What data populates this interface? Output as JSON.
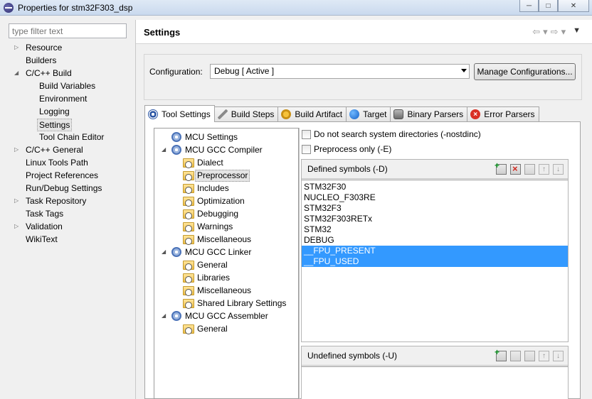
{
  "window": {
    "title": "Properties for stm32F303_dsp",
    "buttons": [
      "─",
      "□",
      "✕"
    ]
  },
  "filter": {
    "placeholder": "type filter text"
  },
  "nav": {
    "items": [
      {
        "label": "Resource",
        "arrow": "▷",
        "child": false
      },
      {
        "label": "Builders",
        "arrow": "",
        "child": false
      },
      {
        "label": "C/C++ Build",
        "arrow": "◢",
        "child": false
      },
      {
        "label": "Build Variables",
        "arrow": "",
        "child": true
      },
      {
        "label": "Environment",
        "arrow": "",
        "child": true
      },
      {
        "label": "Logging",
        "arrow": "",
        "child": true
      },
      {
        "label": "Settings",
        "arrow": "",
        "child": true,
        "selected": true
      },
      {
        "label": "Tool Chain Editor",
        "arrow": "",
        "child": true
      },
      {
        "label": "C/C++ General",
        "arrow": "▷",
        "child": false
      },
      {
        "label": "Linux Tools Path",
        "arrow": "",
        "child": false
      },
      {
        "label": "Project References",
        "arrow": "",
        "child": false
      },
      {
        "label": "Run/Debug Settings",
        "arrow": "",
        "child": false
      },
      {
        "label": "Task Repository",
        "arrow": "▷",
        "child": false
      },
      {
        "label": "Task Tags",
        "arrow": "",
        "child": false
      },
      {
        "label": "Validation",
        "arrow": "▷",
        "child": false
      },
      {
        "label": "WikiText",
        "arrow": "",
        "child": false
      }
    ]
  },
  "header": {
    "title": "Settings",
    "nav": {
      "back": "⇦",
      "back_menu": "▾",
      "forward": "⇨",
      "forward_menu": "▾",
      "view_menu": "▼"
    }
  },
  "configuration": {
    "label": "Configuration:",
    "value": "Debug  [ Active ]",
    "manage_button": "Manage Configurations..."
  },
  "tabs": [
    {
      "label": "Tool Settings",
      "icon": "tool-settings-icon",
      "active": true
    },
    {
      "label": "Build Steps",
      "icon": "build-steps-icon"
    },
    {
      "label": "Build Artifact",
      "icon": "build-artifact-icon"
    },
    {
      "label": "Target",
      "icon": "target-icon"
    },
    {
      "label": "Binary Parsers",
      "icon": "binary-parsers-icon"
    },
    {
      "label": "Error Parsers",
      "icon": "error-parsers-icon"
    }
  ],
  "tool_tree": [
    {
      "label": "MCU Settings",
      "level": 0,
      "icon": "gear",
      "arrow": ""
    },
    {
      "label": "MCU GCC Compiler",
      "level": 0,
      "icon": "gear",
      "arrow": "◢"
    },
    {
      "label": "Dialect",
      "level": 1,
      "icon": "folder"
    },
    {
      "label": "Preprocessor",
      "level": 1,
      "icon": "folder",
      "selected": true
    },
    {
      "label": "Includes",
      "level": 1,
      "icon": "folder"
    },
    {
      "label": "Optimization",
      "level": 1,
      "icon": "folder"
    },
    {
      "label": "Debugging",
      "level": 1,
      "icon": "folder"
    },
    {
      "label": "Warnings",
      "level": 1,
      "icon": "folder"
    },
    {
      "label": "Miscellaneous",
      "level": 1,
      "icon": "folder"
    },
    {
      "label": "MCU GCC Linker",
      "level": 0,
      "icon": "gear",
      "arrow": "◢"
    },
    {
      "label": "General",
      "level": 1,
      "icon": "folder"
    },
    {
      "label": "Libraries",
      "level": 1,
      "icon": "folder"
    },
    {
      "label": "Miscellaneous",
      "level": 1,
      "icon": "folder"
    },
    {
      "label": "Shared Library Settings",
      "level": 1,
      "icon": "folder"
    },
    {
      "label": "MCU GCC Assembler",
      "level": 0,
      "icon": "gear",
      "arrow": "◢"
    },
    {
      "label": "General",
      "level": 1,
      "icon": "folder"
    }
  ],
  "options": {
    "nostdinc": {
      "label": "Do not search system directories (-nostdinc)",
      "checked": false
    },
    "preprocess_only": {
      "label": "Preprocess only (-E)",
      "checked": false
    }
  },
  "defined_symbols": {
    "title": "Defined symbols (-D)",
    "items": [
      {
        "value": "STM32F30"
      },
      {
        "value": "NUCLEO_F303RE"
      },
      {
        "value": "STM32F3"
      },
      {
        "value": "STM32F303RETx"
      },
      {
        "value": "STM32"
      },
      {
        "value": "DEBUG"
      },
      {
        "value": "__FPU_PRESENT",
        "selected": true
      },
      {
        "value": "__FPU_USED",
        "selected": true
      }
    ]
  },
  "undefined_symbols": {
    "title": "Undefined symbols (-U)",
    "items": []
  },
  "colors": {
    "selection": "#3399ff",
    "title_bar": "#c9d9ee"
  }
}
